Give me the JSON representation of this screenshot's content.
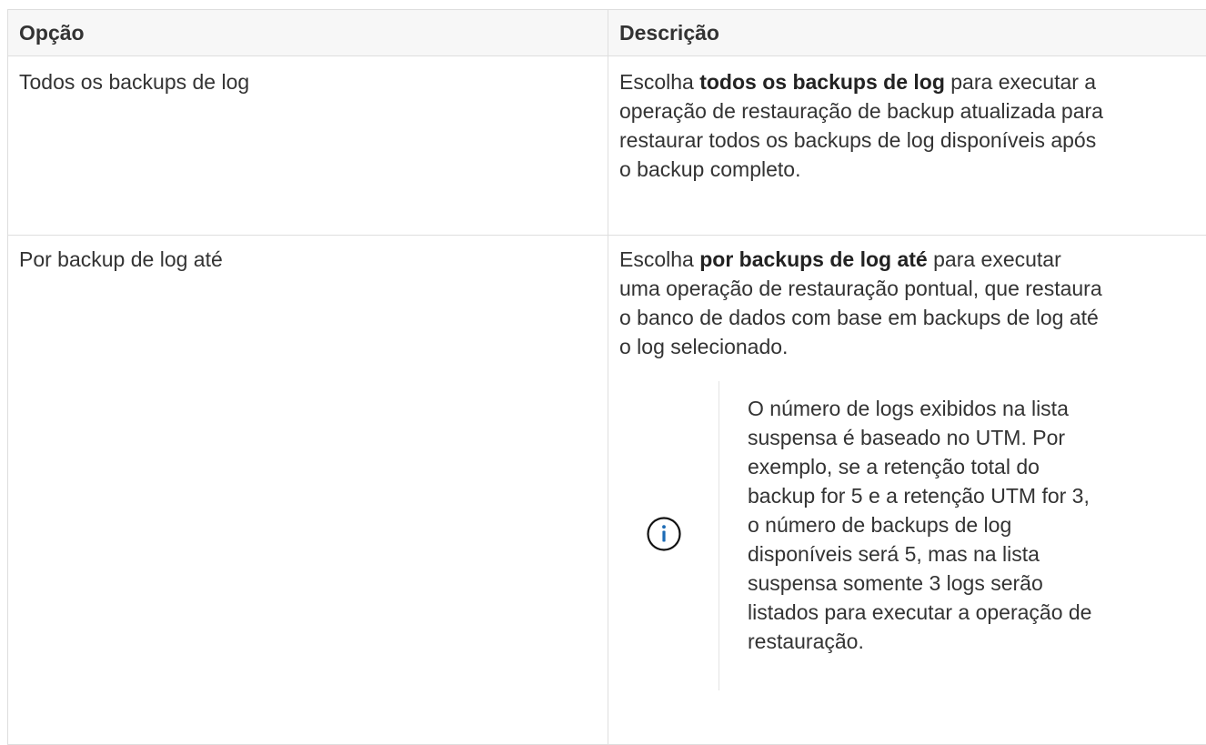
{
  "table": {
    "headers": [
      "Opção",
      "Descrição"
    ],
    "rows": [
      {
        "option": "Todos os backups de log",
        "desc_prefix": "Escolha ",
        "desc_bold": "todos os backups de log",
        "desc_line1_rest": " para executar a",
        "desc_lines": [
          "operação de restauração de backup atualizada para",
          "restaurar todos os backups de log disponíveis após",
          "o backup completo."
        ]
      },
      {
        "option": "Por backup de log até",
        "desc_prefix": "Escolha ",
        "desc_bold": "por backups de log até",
        "desc_line1_rest": " para executar",
        "desc_lines": [
          "uma operação de restauração pontual, que restaura",
          "o banco de dados com base em backups de log até",
          "o log selecionado."
        ],
        "note": {
          "icon": "info-circle-icon",
          "icon_color": "#1c6bb5",
          "lines": [
            "O número de logs exibidos na lista",
            "suspensa é baseado no UTM. Por",
            "exemplo, se a retenção total do",
            "backup for 5 e a retenção UTM for 3,",
            "o número de backups de log",
            "disponíveis será 5, mas na lista",
            "suspensa somente 3 logs serão",
            "listados para executar a operação de",
            "restauração."
          ]
        }
      }
    ]
  }
}
